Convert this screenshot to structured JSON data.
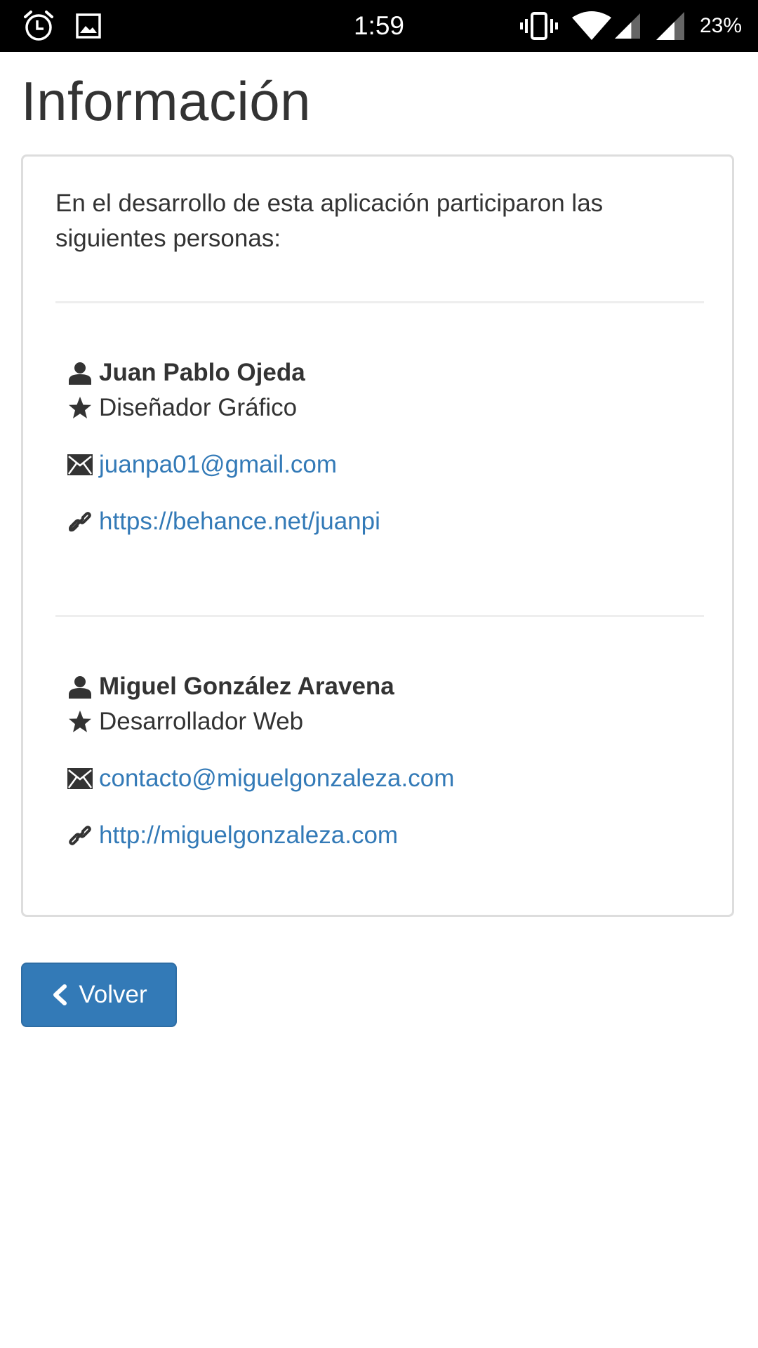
{
  "status_bar": {
    "time": "1:59",
    "battery": "23%",
    "icons": [
      "alarm-icon",
      "gallery-icon",
      "vibrate-icon",
      "wifi-icon",
      "signal-icon",
      "signal-icon"
    ]
  },
  "page": {
    "title": "Información",
    "intro": "En el desarrollo de esta aplicación participaron las siguientes personas:"
  },
  "people": [
    {
      "name": "Juan Pablo Ojeda",
      "role": "Diseñador Gráfico",
      "email": "juanpa01@gmail.com",
      "link": "https://behance.net/juanpi"
    },
    {
      "name": "Miguel González Aravena",
      "role": "Desarrollador Web",
      "email": "contacto@miguelgonzaleza.com",
      "link": "http://miguelgonzaleza.com"
    }
  ],
  "actions": {
    "back_label": "Volver"
  },
  "colors": {
    "link": "#337ab7",
    "button": "#337ab7",
    "text": "#333333",
    "status_bar": "#000000"
  }
}
